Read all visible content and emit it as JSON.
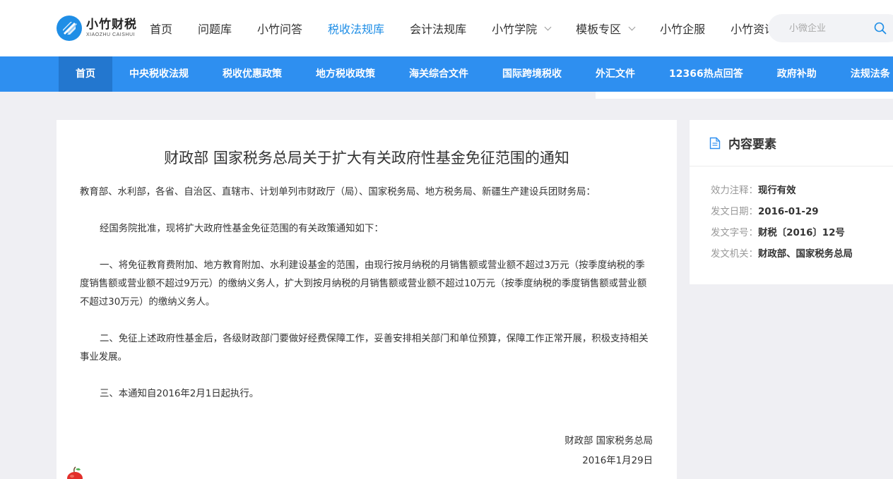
{
  "logo": {
    "name_cn": "小竹财税",
    "name_en": "XIAOZHU CAISHUI"
  },
  "topnav": [
    {
      "label": "首页",
      "dropdown": false,
      "active": false
    },
    {
      "label": "问题库",
      "dropdown": false,
      "active": false
    },
    {
      "label": "小竹问答",
      "dropdown": false,
      "active": false
    },
    {
      "label": "税收法规库",
      "dropdown": false,
      "active": true
    },
    {
      "label": "会计法规库",
      "dropdown": false,
      "active": false
    },
    {
      "label": "小竹学院",
      "dropdown": true,
      "active": false
    },
    {
      "label": "模板专区",
      "dropdown": true,
      "active": false
    },
    {
      "label": "小竹企服",
      "dropdown": false,
      "active": false
    },
    {
      "label": "小竹资讯",
      "dropdown": true,
      "active": false
    }
  ],
  "search": {
    "placeholder": "小微企业"
  },
  "bluenav": [
    {
      "label": "首页",
      "active": true
    },
    {
      "label": "中央税收法规",
      "active": false
    },
    {
      "label": "税收优惠政策",
      "active": false
    },
    {
      "label": "地方税收政策",
      "active": false
    },
    {
      "label": "海关综合文件",
      "active": false
    },
    {
      "label": "国际跨境税收",
      "active": false
    },
    {
      "label": "外汇文件",
      "active": false
    },
    {
      "label": "12366热点回答",
      "active": false
    },
    {
      "label": "政府补助",
      "active": false
    },
    {
      "label": "法规法条",
      "active": false
    }
  ],
  "article": {
    "title": "财政部 国家税务总局关于扩大有关政府性基金免征范围的通知",
    "addressee": "教育部、水利部，各省、自治区、直辖市、计划单列市财政厅（局）、国家税务局、地方税务局、新疆生产建设兵团财务局：",
    "intro": "经国务院批准，现将扩大政府性基金免征范围的有关政策通知如下：",
    "item1": "一、将免征教育费附加、地方教育附加、水利建设基金的范围，由现行按月纳税的月销售额或营业额不超过3万元（按季度纳税的季度销售额或营业额不超过9万元）的缴纳义务人，扩大到按月纳税的月销售额或营业额不超过10万元（按季度纳税的季度销售额或营业额不超过30万元）的缴纳义务人。",
    "item2": "二、免征上述政府性基金后，各级财政部门要做好经费保障工作，妥善安排相关部门和单位预算，保障工作正常开展，积极支持相关事业发展。",
    "item3": "三、本通知自2016年2月1日起执行。",
    "signer": "财政部 国家税务总局",
    "date": "2016年1月29日"
  },
  "side": {
    "title": "内容要素",
    "rows": [
      {
        "key": "效力注释：",
        "value": "现行有效"
      },
      {
        "key": "发文日期：",
        "value": "2016-01-29"
      },
      {
        "key": "发文字号：",
        "value": "财税〔2016〕12号"
      },
      {
        "key": "发文机关：",
        "value": "财政部、国家税务总局"
      }
    ]
  },
  "colors": {
    "brand_blue": "#1f8ee6",
    "nav_blue": "#2e8ff0",
    "nav_active": "#2377cf",
    "background": "#efeff3"
  },
  "icons": [
    "logo-mark-icon",
    "chevron-down-icon",
    "search-icon",
    "document-icon",
    "apple-icon"
  ]
}
